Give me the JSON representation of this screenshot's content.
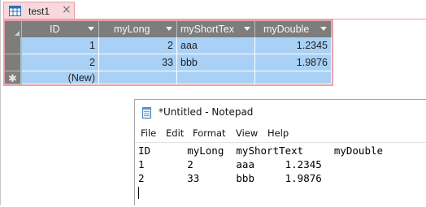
{
  "access": {
    "tab_title": "test1",
    "tab_close": "×",
    "columns": [
      "ID",
      "myLong",
      "myShortTex",
      "myDouble"
    ],
    "rows": [
      {
        "id": "1",
        "mylong": "2",
        "myshorttext": "aaa",
        "mydouble": "1.2345"
      },
      {
        "id": "2",
        "mylong": "33",
        "myshorttext": "bbb",
        "mydouble": "1.9876"
      }
    ],
    "new_row": {
      "glyph": "✱",
      "id": "(New)"
    },
    "colors": {
      "tab_pink": "#f7d8db",
      "grid_border_pink": "#e8a1a9",
      "header_gray": "#7d7d7d",
      "row_blue": "#a9d1f5"
    }
  },
  "notepad": {
    "title": "*Untitled - Notepad",
    "menu": [
      "File",
      "Edit",
      "Format",
      "View",
      "Help"
    ],
    "lines": [
      "ID      myLong  myShortText     myDouble",
      "1       2       aaa     1.2345",
      "2       33      bbb     1.9876"
    ]
  },
  "icons": [
    "table-icon",
    "close-icon",
    "dropdown-arrow-icon",
    "new-record-icon",
    "notepad-icon"
  ]
}
